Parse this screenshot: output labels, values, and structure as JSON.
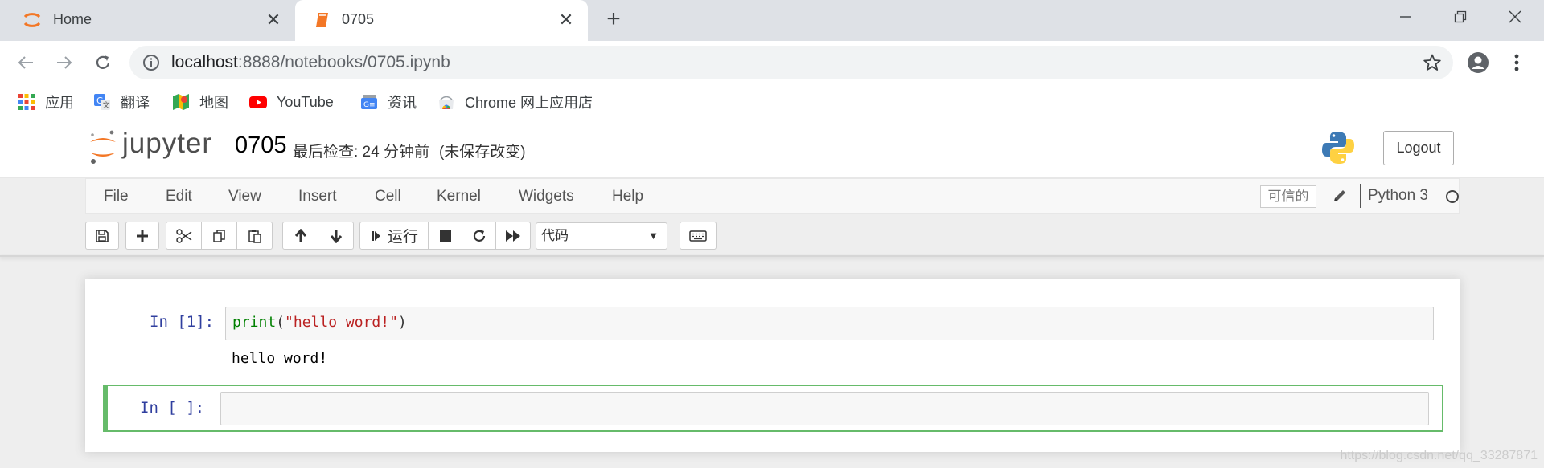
{
  "browser": {
    "tabs": [
      {
        "title": "Home",
        "icon": "jupyter-favicon",
        "active": false
      },
      {
        "title": "0705",
        "icon": "notebook-favicon",
        "active": true
      }
    ],
    "new_tab_icon": "plus-icon",
    "window_controls": [
      "minimize-icon",
      "restore-icon",
      "close-icon"
    ],
    "url": {
      "host": "localhost",
      "path": ":8888/notebooks/0705.ipynb"
    },
    "bookmarks": [
      {
        "label": "应用",
        "icon": "apps-grid-icon"
      },
      {
        "label": "翻译",
        "icon": "translate-icon"
      },
      {
        "label": "地图",
        "icon": "maps-icon"
      },
      {
        "label": "YouTube",
        "icon": "youtube-icon"
      },
      {
        "label": "资讯",
        "icon": "news-icon"
      },
      {
        "label": "Chrome 网上应用店",
        "icon": "webstore-icon"
      }
    ]
  },
  "jupyter": {
    "wordmark": "jupyter",
    "notebook_name": "0705",
    "checkpoint": "最后检查: 24 分钟前",
    "autosave": "(未保存改变)",
    "logout_label": "Logout",
    "menu": [
      "File",
      "Edit",
      "View",
      "Insert",
      "Cell",
      "Kernel",
      "Widgets",
      "Help"
    ],
    "trusted_label": "可信的",
    "kernel_name": "Python 3",
    "run_label": "运行",
    "cell_type": "代码"
  },
  "cells": [
    {
      "prompt": "In [1]:",
      "code_fn": "print",
      "code_str": "\"hello word!\"",
      "output": "hello word!"
    },
    {
      "prompt": "In [ ]:",
      "code": ""
    }
  ],
  "watermark": "https://blog.csdn.net/qq_33287871",
  "colors": {
    "jupyter_orange": "#f37726",
    "selected_cell_border": "#66bb6a",
    "prompt_blue": "#303f9f"
  }
}
